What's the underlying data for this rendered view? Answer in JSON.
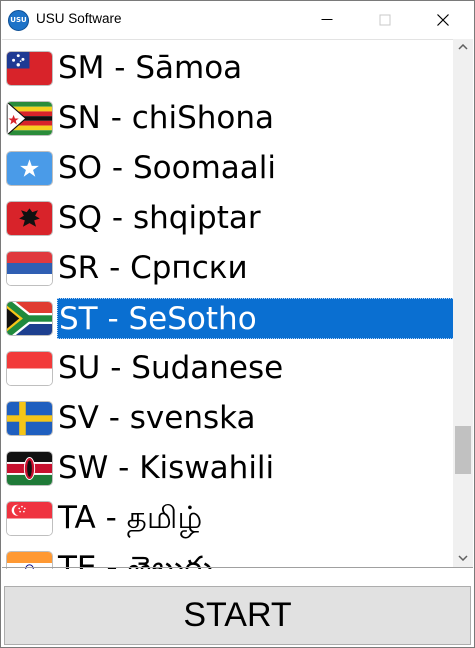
{
  "window": {
    "title": "USU Software",
    "app_icon_text": "USU"
  },
  "languages": [
    {
      "label": "SM - Sāmoa",
      "flag": "samoa-flag",
      "selected": false
    },
    {
      "label": "SN - chiShona",
      "flag": "zimbabwe-flag",
      "selected": false
    },
    {
      "label": "SO - Soomaali",
      "flag": "somalia-flag",
      "selected": false
    },
    {
      "label": "SQ - shqiptar",
      "flag": "albania-flag",
      "selected": false
    },
    {
      "label": "SR - Српски",
      "flag": "serbia-flag",
      "selected": false
    },
    {
      "label": "ST - SeSotho",
      "flag": "south-africa-flag",
      "selected": true
    },
    {
      "label": "SU - Sudanese",
      "flag": "indonesia-flag",
      "selected": false
    },
    {
      "label": "SV - svenska",
      "flag": "sweden-flag",
      "selected": false
    },
    {
      "label": "SW - Kiswahili",
      "flag": "kenya-flag",
      "selected": false
    },
    {
      "label": "TA - தமிழ்",
      "flag": "singapore-flag",
      "selected": false
    },
    {
      "label": "TE - తెలుగు",
      "flag": "india-flag",
      "selected": false
    }
  ],
  "start_button": {
    "label": "START"
  },
  "colors": {
    "selection": "#0a6fd1",
    "button_bg": "#e1e1e1"
  }
}
